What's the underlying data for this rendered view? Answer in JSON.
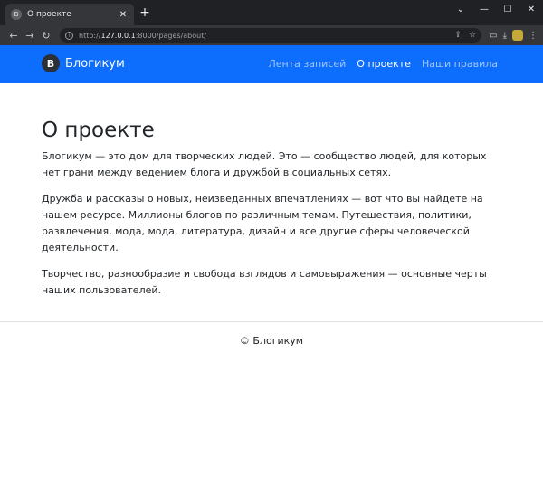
{
  "browser": {
    "tab_title": "О проекте",
    "favicon_letter": "B",
    "new_tab": "+",
    "url_prefix": "http://",
    "url_host": "127.0.0.1",
    "url_rest": ":8000/pages/about/"
  },
  "navbar": {
    "brand_letter": "B",
    "brand_name": "Блогикум",
    "links": [
      {
        "label": "Лента записей"
      },
      {
        "label": "О проекте"
      },
      {
        "label": "Наши правила"
      }
    ],
    "bg_color": "#0d6efd"
  },
  "main": {
    "title": "О проекте",
    "paragraphs": [
      "Блогикум — это дом для творческих людей. Это — сообщество людей, для которых нет грани между ведением блога и дружбой в социальных сетях.",
      "Дружба и рассказы о новых, неизведанных впечатлениях — вот что вы найдете на нашем ресурсе. Миллионы блогов по различным темам. Путешествия, политики, развлечения, мода, мода, литература, дизайн и все другие сферы человеческой деятельности.",
      "Творчество, разнообразие и свобода взглядов и самовыражения — основные черты наших пользователей."
    ]
  },
  "footer": {
    "text": "© Блогикум"
  }
}
